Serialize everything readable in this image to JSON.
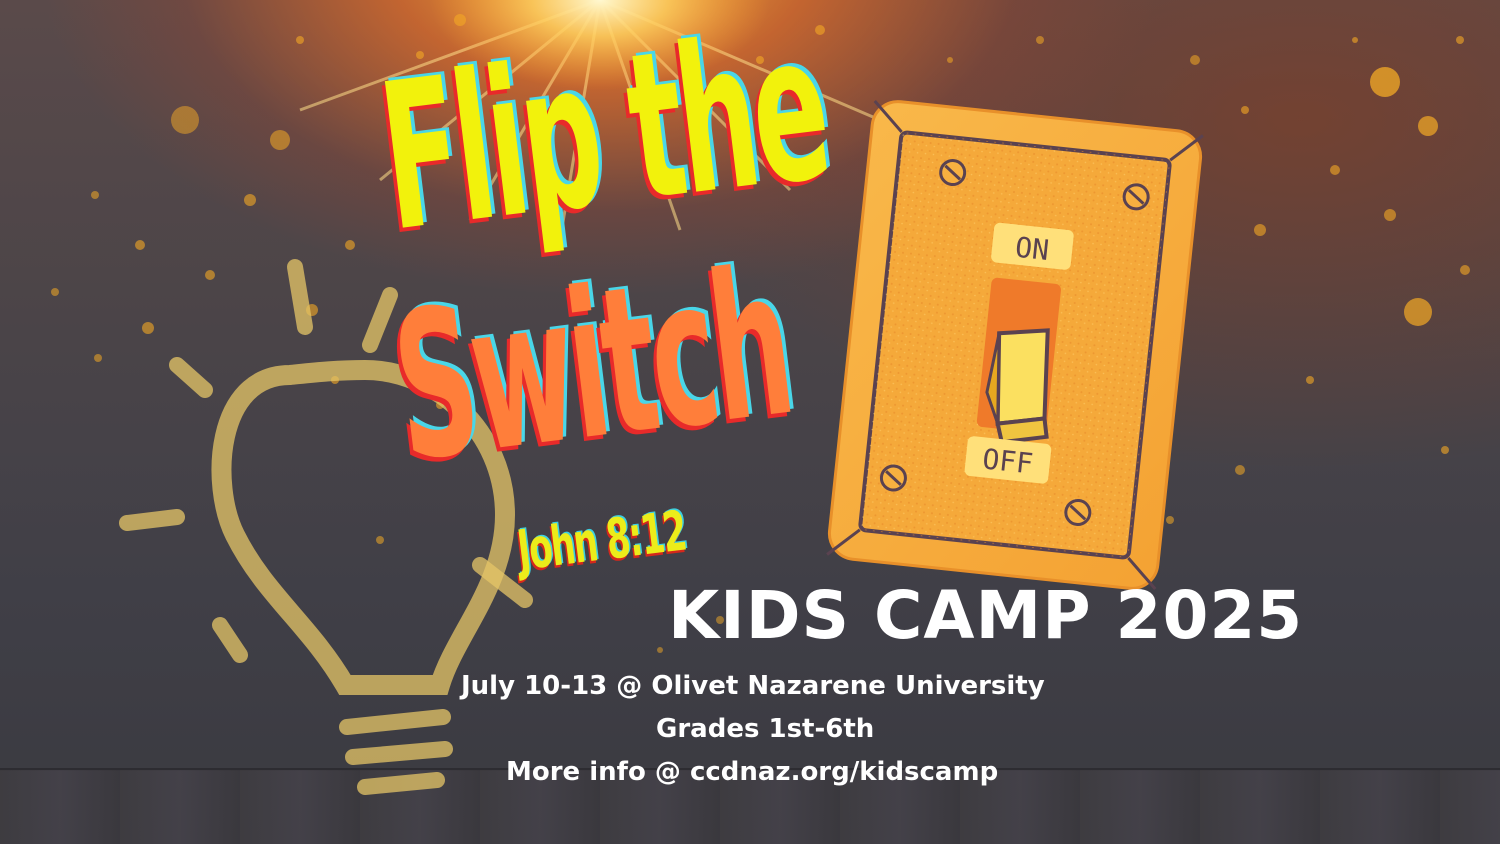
{
  "poster": {
    "title_line1": "Flip the",
    "title_line2": "Switch",
    "verse": "John 8:12",
    "camp_title": "KIDS CAMP 2025",
    "dates_location": "July 10-13 @ Olivet Nazarene University",
    "grades": "Grades 1st-6th",
    "more_info": "More info @ ccdnaz.org/kidscamp"
  },
  "switch": {
    "on_label": "ON",
    "off_label": "OFF"
  },
  "icons": {
    "bulb": "lightbulb-icon",
    "switch": "light-switch-icon"
  },
  "colors": {
    "title_line1": "#f2f20c",
    "title_line2": "#ff7e3a",
    "shadow_red": "#e82a2a",
    "shadow_cyan": "#49d6e8",
    "plate_orange": "#f7a935",
    "bulb_outline": "#e6c567",
    "text_white": "#ffffff"
  }
}
